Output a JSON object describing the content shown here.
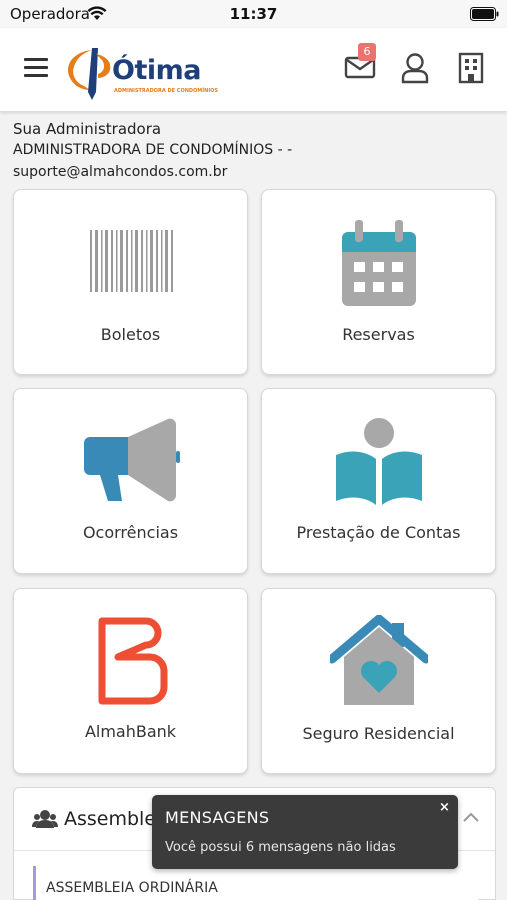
{
  "status_bar": {
    "carrier": "Operadora",
    "time": "11:37"
  },
  "header": {
    "logo_text": "Ótima",
    "logo_tagline": "ADMINISTRADORA DE CONDOMÍNIOS",
    "mail_badge": "6"
  },
  "admin": {
    "title": "Sua Administradora",
    "name": "ADMINISTRADORA DE CONDOMÍNIOS - -",
    "email": "suporte@almahcondos.com.br"
  },
  "tiles": [
    {
      "label": "Boletos",
      "icon": "barcode-icon"
    },
    {
      "label": "Reservas",
      "icon": "calendar-icon"
    },
    {
      "label": "Ocorrências",
      "icon": "megaphone-icon"
    },
    {
      "label": "Prestação de Contas",
      "icon": "reader-book-icon"
    },
    {
      "label": "AlmahBank",
      "icon": "almahbank-logo-icon"
    },
    {
      "label": "Seguro Residencial",
      "icon": "house-heart-icon"
    }
  ],
  "assembleias": {
    "title": "Assembleias",
    "items": [
      {
        "label": "ASSEMBLEIA ORDINÁRIA"
      }
    ]
  },
  "toast": {
    "title": "MENSAGENS",
    "message": "Você possui 6 mensagens não lidas",
    "close": "×"
  },
  "colors": {
    "brand_blue": "#1f3f7a",
    "brand_orange": "#e47d1a",
    "teal": "#3aa3b8",
    "steel_blue": "#3a8ab8",
    "almah_red": "#ee4e33",
    "badge": "#e9736d",
    "toast_bg": "#3b3b3b"
  }
}
